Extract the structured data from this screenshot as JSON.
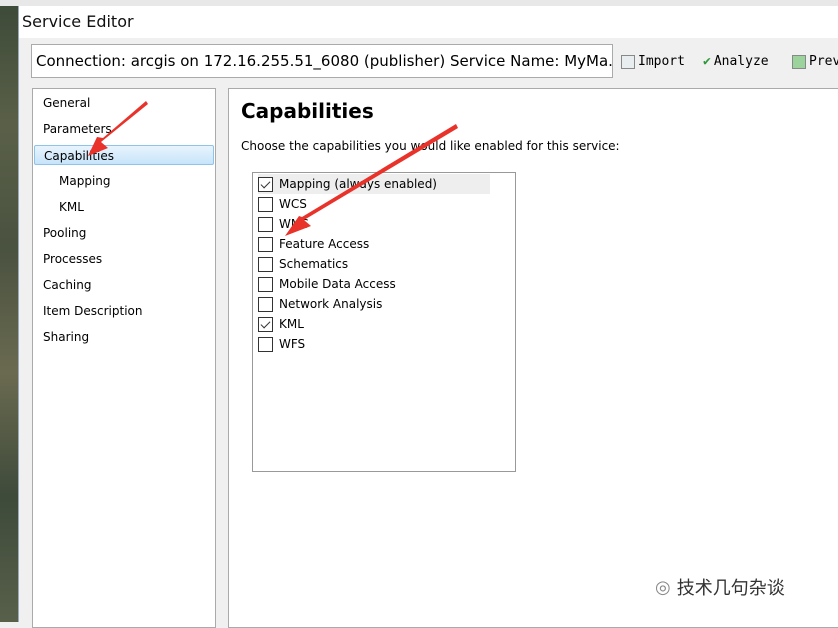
{
  "window": {
    "title": "Service Editor"
  },
  "connection": "Connection: arcgis on 172.16.255.51_6080 (publisher)   Service Name: MyMa...",
  "toolbar": {
    "import": "Import",
    "analyze": "Analyze",
    "preview": "Prev"
  },
  "nav": [
    {
      "label": "General"
    },
    {
      "label": "Parameters"
    },
    {
      "label": "Capabilities",
      "selected": true
    },
    {
      "label": "Mapping",
      "sub": true
    },
    {
      "label": "KML",
      "sub": true
    },
    {
      "label": "Pooling"
    },
    {
      "label": "Processes"
    },
    {
      "label": "Caching"
    },
    {
      "label": "Item Description"
    },
    {
      "label": "Sharing"
    }
  ],
  "main": {
    "heading": "Capabilities",
    "description": "Choose the capabilities you would like enabled for this service:",
    "capabilities": [
      {
        "label": "Mapping (always enabled)",
        "checked": true
      },
      {
        "label": "WCS",
        "checked": false
      },
      {
        "label": "WMS",
        "checked": false
      },
      {
        "label": "Feature Access",
        "checked": false
      },
      {
        "label": "Schematics",
        "checked": false
      },
      {
        "label": "Mobile Data Access",
        "checked": false
      },
      {
        "label": "Network Analysis",
        "checked": false
      },
      {
        "label": "KML",
        "checked": true
      },
      {
        "label": "WFS",
        "checked": false
      }
    ]
  },
  "watermark": "技术几句杂谈",
  "colors": {
    "selection": "#c7e4fa",
    "arrow": "#e8322a",
    "analyze_check": "#2e9a3a"
  }
}
